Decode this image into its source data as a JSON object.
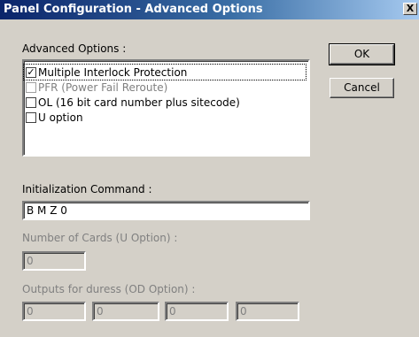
{
  "window": {
    "title": "Panel Configuration - Advanced Options",
    "close_label": "X"
  },
  "advanced": {
    "label": "Advanced Options :",
    "options": [
      {
        "label": "Multiple Interlock Protection",
        "checked": true,
        "enabled": true
      },
      {
        "label": "PFR (Power Fail Reroute)",
        "checked": false,
        "enabled": false
      },
      {
        "label": "OL (16 bit card number plus sitecode)",
        "checked": false,
        "enabled": true
      },
      {
        "label": "U option",
        "checked": false,
        "enabled": true
      }
    ]
  },
  "buttons": {
    "ok": "OK",
    "cancel": "Cancel"
  },
  "init_command": {
    "label": "Initialization Command :",
    "value": "B M Z 0"
  },
  "num_cards": {
    "label": "Number of Cards (U Option)  :",
    "value": "0"
  },
  "duress": {
    "label": "Outputs for duress (OD Option) :",
    "values": [
      "0",
      "0",
      "0",
      "0"
    ]
  }
}
